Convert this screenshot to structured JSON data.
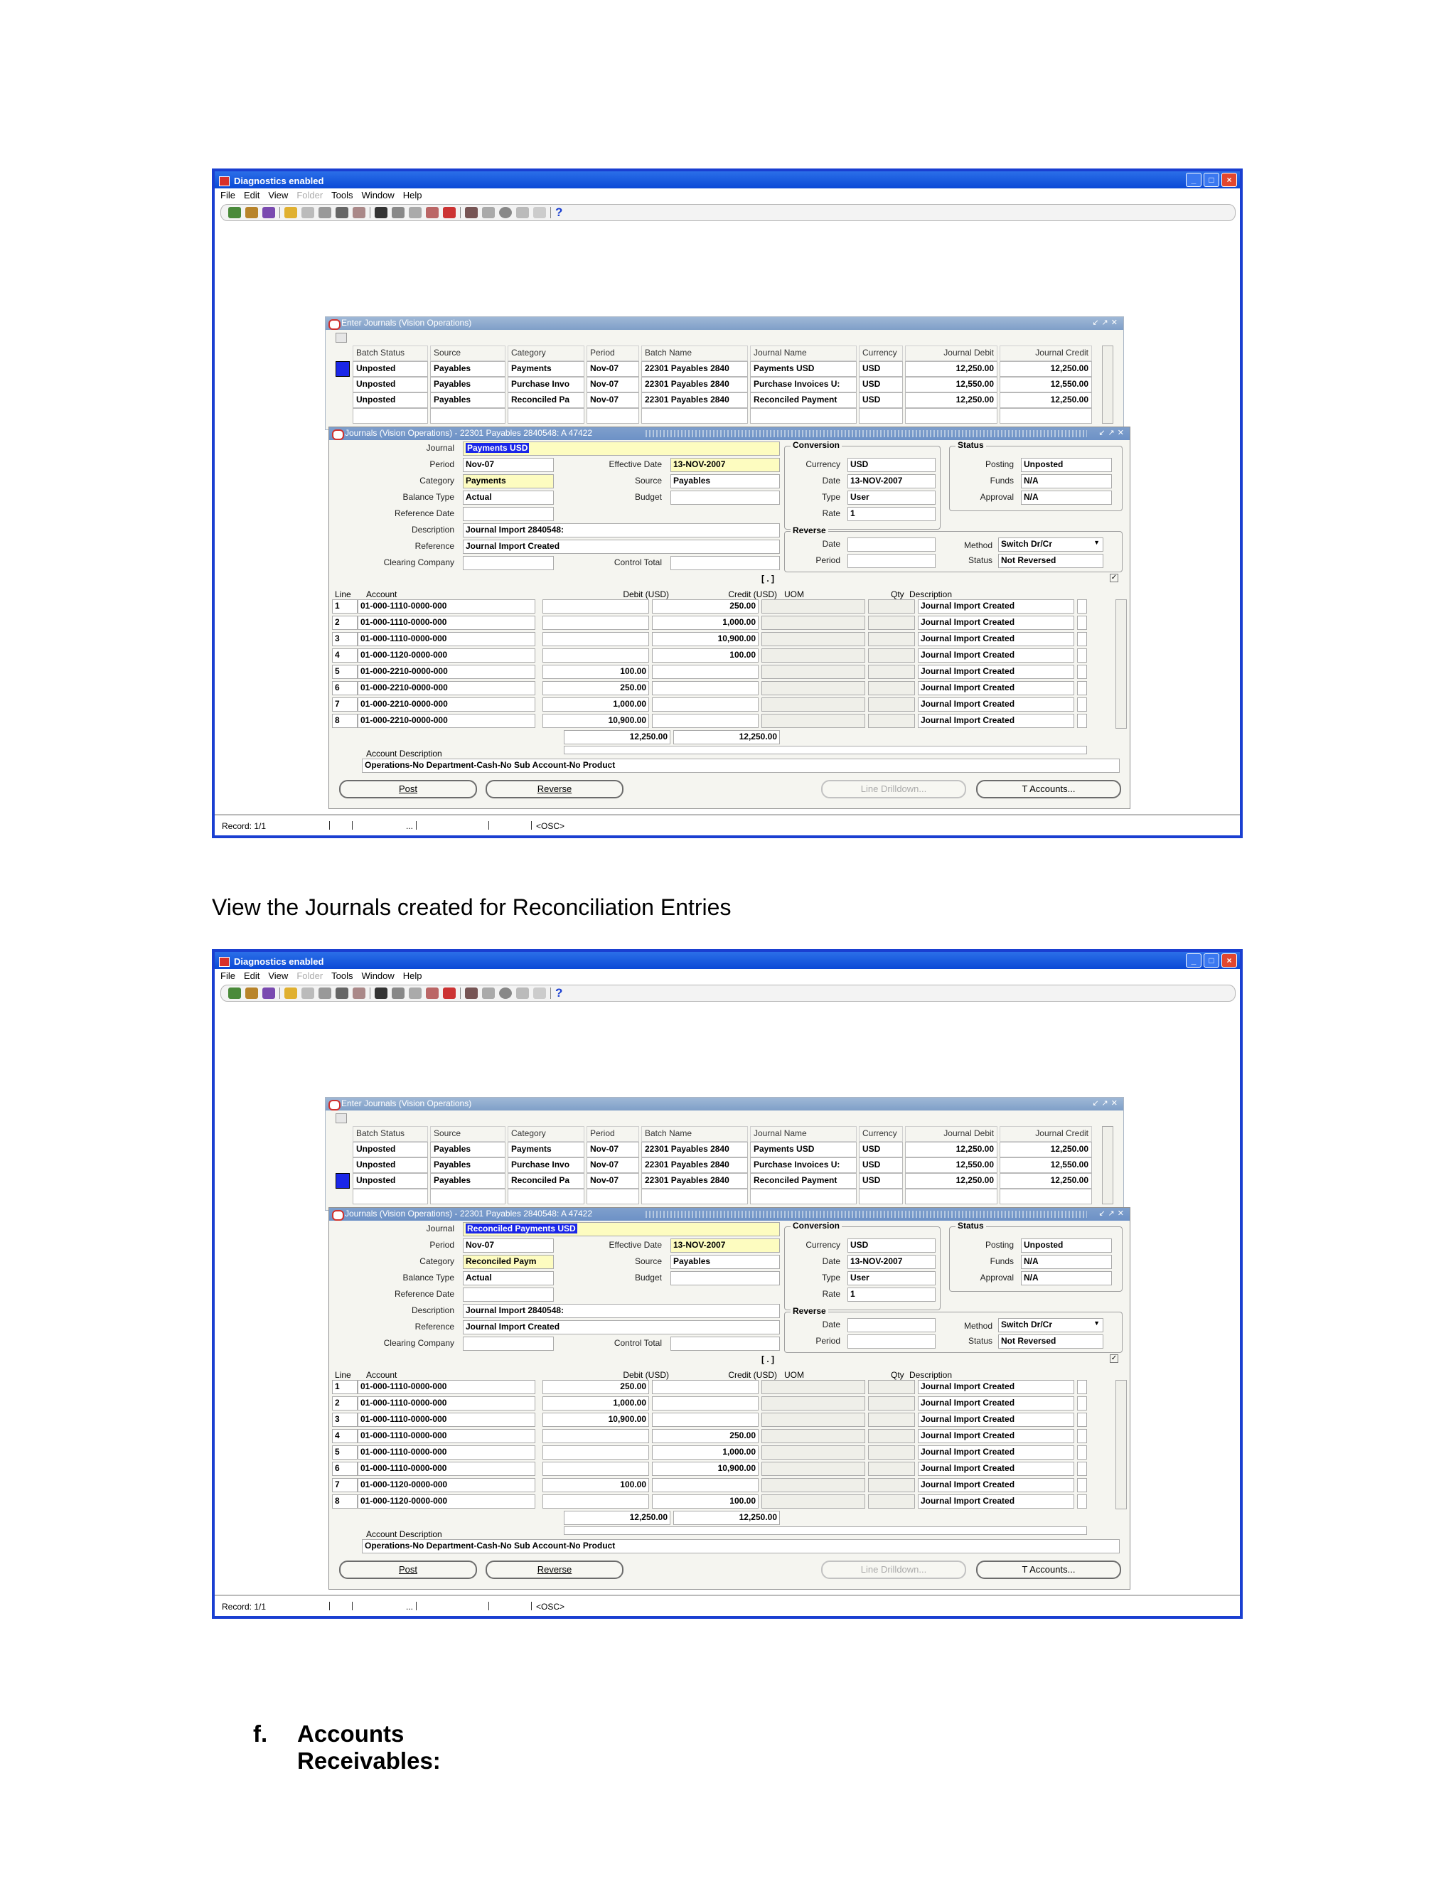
{
  "window": {
    "title": "Diagnostics enabled",
    "menu": [
      "File",
      "Edit",
      "View",
      "Folder",
      "Tools",
      "Window",
      "Help"
    ],
    "menu_disabled": "Folder",
    "status_record": "Record: 1/1",
    "status_dots": "...",
    "status_osc": "<OSC>"
  },
  "enter_journals": {
    "title": "Enter Journals (Vision Operations)",
    "headers": [
      "Batch Status",
      "Source",
      "Category",
      "Period",
      "Batch Name",
      "Journal Name",
      "Currency",
      "Journal Debit",
      "Journal Credit"
    ]
  },
  "journal_form": {
    "labels": {
      "journal": "Journal",
      "period": "Period",
      "category": "Category",
      "balance_type": "Balance Type",
      "reference_date": "Reference Date",
      "description": "Description",
      "reference": "Reference",
      "clearing_company": "Clearing Company",
      "effective_date": "Effective Date",
      "source": "Source",
      "budget": "Budget",
      "control_total": "Control Total",
      "conversion": "Conversion",
      "currency": "Currency",
      "date": "Date",
      "type": "Type",
      "rate": "Rate",
      "status": "Status",
      "posting": "Posting",
      "funds": "Funds",
      "approval": "Approval",
      "reverse": "Reverse",
      "reverse_period": "Period",
      "method": "Method",
      "reverse_status": "Status",
      "line": "Line",
      "account": "Account",
      "debit": "Debit (USD)",
      "credit": "Credit (USD)",
      "uom": "UOM",
      "qty": "Qty",
      "line_description": "Description",
      "account_description": "Account Description"
    },
    "buttons": {
      "post": "Post",
      "reverse": "Reverse",
      "line_drilldown": "Line Drilldown...",
      "t_accounts": "T Accounts..."
    }
  },
  "screenshots": [
    {
      "batches": [
        {
          "status": "Unposted",
          "source": "Payables",
          "category": "Payments",
          "period": "Nov-07",
          "batch": "22301 Payables 2840",
          "journal": "Payments USD",
          "currency": "USD",
          "debit": "12,250.00",
          "credit": "12,250.00",
          "selected": true
        },
        {
          "status": "Unposted",
          "source": "Payables",
          "category": "Purchase Invo",
          "period": "Nov-07",
          "batch": "22301 Payables 2840",
          "journal": "Purchase Invoices U:",
          "currency": "USD",
          "debit": "12,550.00",
          "credit": "12,550.00",
          "selected": false
        },
        {
          "status": "Unposted",
          "source": "Payables",
          "category": "Reconciled Pa",
          "period": "Nov-07",
          "batch": "22301 Payables 2840",
          "journal": "Reconciled Payment",
          "currency": "USD",
          "debit": "12,250.00",
          "credit": "12,250.00",
          "selected": false
        }
      ],
      "journal_title": "Journals (Vision Operations) - 22301 Payables 2840548: A 47422",
      "journal": "Payments USD",
      "period": "Nov-07",
      "category": "Payments",
      "balance_type": "Actual",
      "description": "Journal Import 2840548:",
      "reference": "Journal Import Created",
      "effective_date": "13-NOV-2007",
      "source": "Payables",
      "currency": "USD",
      "conv_date": "13-NOV-2007",
      "conv_type": "User",
      "rate": "1",
      "posting": "Unposted",
      "funds": "N/A",
      "approval": "N/A",
      "method": "Switch Dr/Cr",
      "reverse_status": "Not Reversed",
      "lines": [
        {
          "n": "1",
          "account": "01-000-1110-0000-000",
          "debit": "",
          "credit": "250.00",
          "desc": "Journal Import Created"
        },
        {
          "n": "2",
          "account": "01-000-1110-0000-000",
          "debit": "",
          "credit": "1,000.00",
          "desc": "Journal Import Created"
        },
        {
          "n": "3",
          "account": "01-000-1110-0000-000",
          "debit": "",
          "credit": "10,900.00",
          "desc": "Journal Import Created"
        },
        {
          "n": "4",
          "account": "01-000-1120-0000-000",
          "debit": "",
          "credit": "100.00",
          "desc": "Journal Import Created"
        },
        {
          "n": "5",
          "account": "01-000-2210-0000-000",
          "debit": "100.00",
          "credit": "",
          "desc": "Journal Import Created"
        },
        {
          "n": "6",
          "account": "01-000-2210-0000-000",
          "debit": "250.00",
          "credit": "",
          "desc": "Journal Import Created"
        },
        {
          "n": "7",
          "account": "01-000-2210-0000-000",
          "debit": "1,000.00",
          "credit": "",
          "desc": "Journal Import Created"
        },
        {
          "n": "8",
          "account": "01-000-2210-0000-000",
          "debit": "10,900.00",
          "credit": "",
          "desc": "Journal Import Created"
        }
      ],
      "total_debit": "12,250.00",
      "total_credit": "12,250.00",
      "account_description": "Operations-No Department-Cash-No Sub Account-No Product"
    },
    {
      "batches": [
        {
          "status": "Unposted",
          "source": "Payables",
          "category": "Payments",
          "period": "Nov-07",
          "batch": "22301 Payables 2840",
          "journal": "Payments USD",
          "currency": "USD",
          "debit": "12,250.00",
          "credit": "12,250.00",
          "selected": false
        },
        {
          "status": "Unposted",
          "source": "Payables",
          "category": "Purchase Invo",
          "period": "Nov-07",
          "batch": "22301 Payables 2840",
          "journal": "Purchase Invoices U:",
          "currency": "USD",
          "debit": "12,550.00",
          "credit": "12,550.00",
          "selected": false
        },
        {
          "status": "Unposted",
          "source": "Payables",
          "category": "Reconciled Pa",
          "period": "Nov-07",
          "batch": "22301 Payables 2840",
          "journal": "Reconciled Payment",
          "currency": "USD",
          "debit": "12,250.00",
          "credit": "12,250.00",
          "selected": true
        }
      ],
      "journal_title": "Journals (Vision Operations) - 22301 Payables 2840548: A 47422",
      "journal": "Reconciled Payments USD",
      "period": "Nov-07",
      "category": "Reconciled Paym",
      "balance_type": "Actual",
      "description": "Journal Import 2840548:",
      "reference": "Journal Import Created",
      "effective_date": "13-NOV-2007",
      "source": "Payables",
      "currency": "USD",
      "conv_date": "13-NOV-2007",
      "conv_type": "User",
      "rate": "1",
      "posting": "Unposted",
      "funds": "N/A",
      "approval": "N/A",
      "method": "Switch Dr/Cr",
      "reverse_status": "Not Reversed",
      "lines": [
        {
          "n": "1",
          "account": "01-000-1110-0000-000",
          "debit": "250.00",
          "credit": "",
          "desc": "Journal Import Created"
        },
        {
          "n": "2",
          "account": "01-000-1110-0000-000",
          "debit": "1,000.00",
          "credit": "",
          "desc": "Journal Import Created"
        },
        {
          "n": "3",
          "account": "01-000-1110-0000-000",
          "debit": "10,900.00",
          "credit": "",
          "desc": "Journal Import Created"
        },
        {
          "n": "4",
          "account": "01-000-1110-0000-000",
          "debit": "",
          "credit": "250.00",
          "desc": "Journal Import Created"
        },
        {
          "n": "5",
          "account": "01-000-1110-0000-000",
          "debit": "",
          "credit": "1,000.00",
          "desc": "Journal Import Created"
        },
        {
          "n": "6",
          "account": "01-000-1110-0000-000",
          "debit": "",
          "credit": "10,900.00",
          "desc": "Journal Import Created"
        },
        {
          "n": "7",
          "account": "01-000-1120-0000-000",
          "debit": "100.00",
          "credit": "",
          "desc": "Journal Import Created"
        },
        {
          "n": "8",
          "account": "01-000-1120-0000-000",
          "debit": "",
          "credit": "100.00",
          "desc": "Journal Import Created"
        }
      ],
      "total_debit": "12,250.00",
      "total_credit": "12,250.00",
      "account_description": "Operations-No Department-Cash-No Sub Account-No Product"
    }
  ],
  "caption": "View the Journals created for Reconciliation Entries",
  "section": {
    "number": "f.",
    "title": "Accounts Receivables:"
  }
}
